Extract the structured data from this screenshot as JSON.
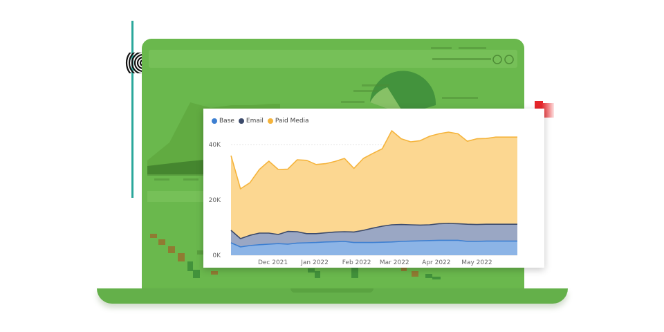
{
  "chart_data": {
    "type": "area",
    "stacked": true,
    "title": "",
    "xlabel": "",
    "ylabel": "",
    "ylim": [
      0,
      46000
    ],
    "yticks": [
      0,
      20000,
      40000
    ],
    "ytick_labels": [
      "0K",
      "20K",
      "40K"
    ],
    "xtick_labels": [
      "Dec 2021",
      "Jan 2022",
      "Feb 2022",
      "Mar 2022",
      "Apr 2022",
      "May 2022"
    ],
    "x_start": "2021-11-15",
    "x_end": "2022-06-15",
    "grid": true,
    "legend": "top-left",
    "x": [
      "2021-11-15",
      "2021-11-22",
      "2021-11-29",
      "2021-12-06",
      "2021-12-13",
      "2021-12-20",
      "2021-12-27",
      "2022-01-03",
      "2022-01-10",
      "2022-01-17",
      "2022-01-24",
      "2022-01-31",
      "2022-02-07",
      "2022-02-14",
      "2022-02-21",
      "2022-02-28",
      "2022-03-07",
      "2022-03-14",
      "2022-03-21",
      "2022-03-28",
      "2022-04-04",
      "2022-04-11",
      "2022-04-18",
      "2022-04-25",
      "2022-05-02",
      "2022-05-09",
      "2022-05-16",
      "2022-05-23",
      "2022-05-30",
      "2022-06-15"
    ],
    "series": [
      {
        "name": "Base",
        "color": "#3d7fd1",
        "fill": "#8cb4e6",
        "values": [
          4500,
          3000,
          3500,
          3800,
          4000,
          4200,
          4000,
          4400,
          4500,
          4600,
          4800,
          4900,
          5000,
          4600,
          4600,
          4600,
          4700,
          4800,
          5000,
          5100,
          5200,
          5300,
          5400,
          5400,
          5400,
          5000,
          5000,
          5100,
          5100,
          5100
        ]
      },
      {
        "name": "Email",
        "color": "#3b4a6b",
        "fill": "#9aa7c4",
        "values": [
          4500,
          3000,
          3700,
          4200,
          4000,
          3300,
          4600,
          4100,
          3300,
          3200,
          3300,
          3500,
          3500,
          3800,
          4400,
          5200,
          5800,
          6200,
          6100,
          5900,
          5700,
          5700,
          6000,
          6100,
          6000,
          6200,
          6100,
          6100,
          6100,
          6100
        ]
      },
      {
        "name": "Paid Media",
        "color": "#f5b43c",
        "fill": "#fcd791",
        "values": [
          27000,
          18000,
          19000,
          23000,
          26000,
          23500,
          22500,
          26000,
          26500,
          25000,
          25000,
          25500,
          26500,
          23000,
          26000,
          27000,
          28000,
          34000,
          31000,
          30000,
          30500,
          32000,
          32500,
          33000,
          32500,
          30000,
          31000,
          31000,
          31500,
          31500
        ]
      }
    ]
  }
}
